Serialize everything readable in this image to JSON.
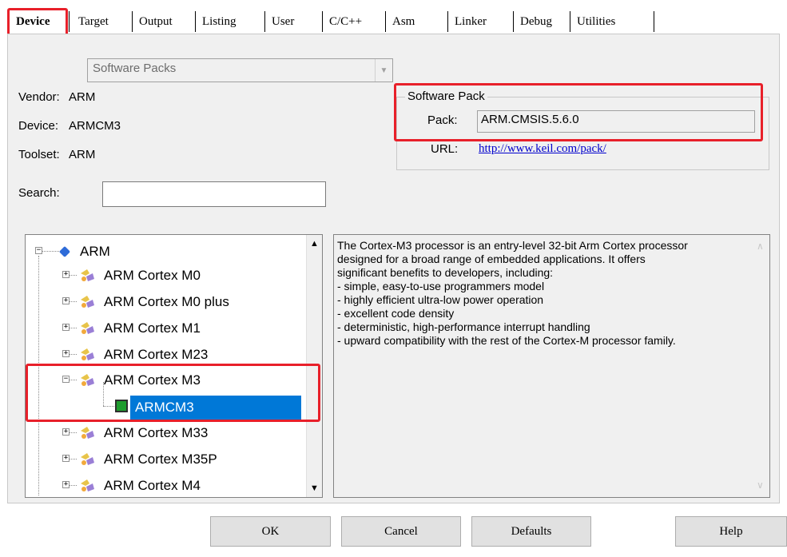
{
  "tabs": [
    "Device",
    "Target",
    "Output",
    "Listing",
    "User",
    "C/C++",
    "Asm",
    "Linker",
    "Debug",
    "Utilities"
  ],
  "active_tab": "Device",
  "database": {
    "selected": "Software Packs"
  },
  "vendor": {
    "label": "Vendor:",
    "value": "ARM"
  },
  "device": {
    "label": "Device:",
    "value": "ARMCM3"
  },
  "toolset": {
    "label": "Toolset:",
    "value": "ARM"
  },
  "search": {
    "label": "Search:",
    "value": ""
  },
  "software_pack": {
    "title": "Software Pack",
    "pack_label": "Pack:",
    "pack_value": "ARM.CMSIS.5.6.0",
    "url_label": "URL:",
    "url_value": "http://www.keil.com/pack/"
  },
  "tree": {
    "vendor": "ARM",
    "families": [
      "ARM Cortex M0",
      "ARM Cortex M0 plus",
      "ARM Cortex M1",
      "ARM Cortex M23",
      "ARM Cortex M3",
      "ARM Cortex M33",
      "ARM Cortex M35P",
      "ARM Cortex M4"
    ],
    "expanded_family": "ARM Cortex M3",
    "selected_device": "ARMCM3"
  },
  "description": [
    "The Cortex-M3 processor is an entry-level 32-bit Arm Cortex processor",
    "designed for a broad range of embedded applications. It offers",
    "significant benefits to developers, including:",
    "- simple, easy-to-use programmers model",
    "- highly efficient ultra-low power operation",
    "- excellent code density",
    "- deterministic, high-performance interrupt handling",
    "- upward compatibility with the rest of the Cortex-M processor family."
  ],
  "buttons": {
    "ok": "OK",
    "cancel": "Cancel",
    "defaults": "Defaults",
    "help": "Help"
  },
  "colors": {
    "highlight": "#e8202a",
    "selection": "#0078d7",
    "link": "#0000cc"
  }
}
